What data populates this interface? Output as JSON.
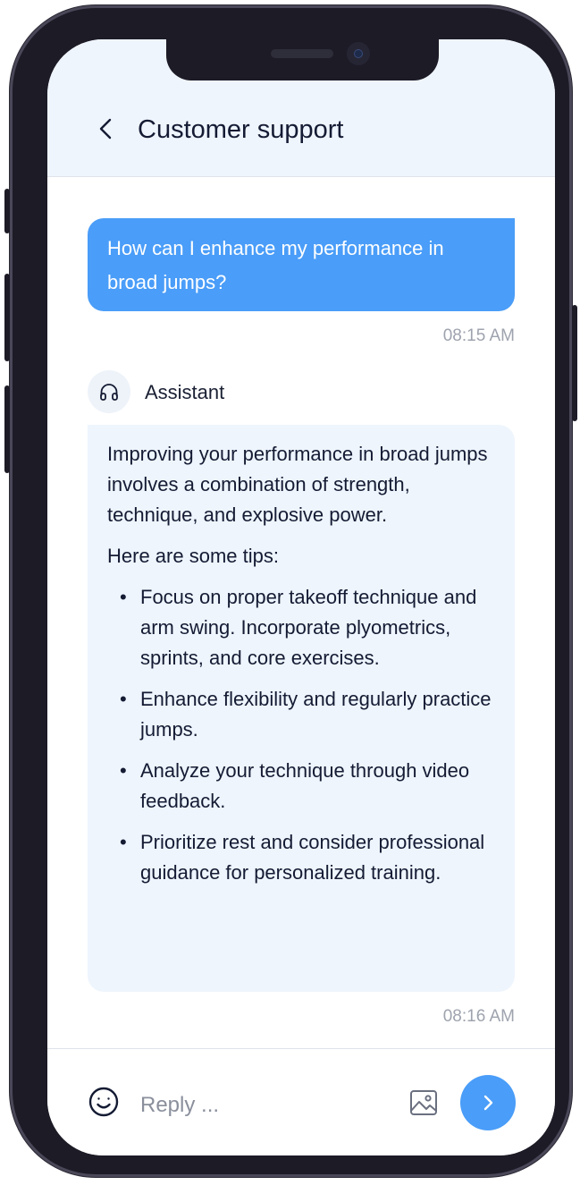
{
  "header": {
    "back_icon": "chevron-left-icon",
    "title": "Customer support"
  },
  "messages": [
    {
      "role": "user",
      "text": "How can I enhance my performance in broad jumps?",
      "time": "08:15 AM"
    },
    {
      "role": "assistant",
      "sender": "Assistant",
      "avatar_icon": "headphones-icon",
      "intro": "Improving your performance in broad jumps involves a combination of strength, technique, and explosive power.",
      "lead": "Here are some tips:",
      "tips": [
        "Focus on proper takeoff technique and arm swing. Incorporate plyometrics, sprints, and core exercises.",
        "Enhance flexibility and regularly practice jumps.",
        "Analyze your technique through video feedback.",
        "Prioritize rest and consider professional guidance for personalized training."
      ],
      "bullet": "•",
      "time": "08:16 AM"
    }
  ],
  "composer": {
    "placeholder": "Reply ...",
    "emoji_icon": "smiley-icon",
    "image_icon": "image-icon",
    "send_icon": "chevron-right-icon"
  },
  "colors": {
    "accent": "#4a9df8",
    "header_bg": "#eff5fd",
    "assistant_bubble": "#eef5fd",
    "text": "#141b33",
    "timestamp": "#9ea3ae",
    "device": "#1c1b26"
  }
}
